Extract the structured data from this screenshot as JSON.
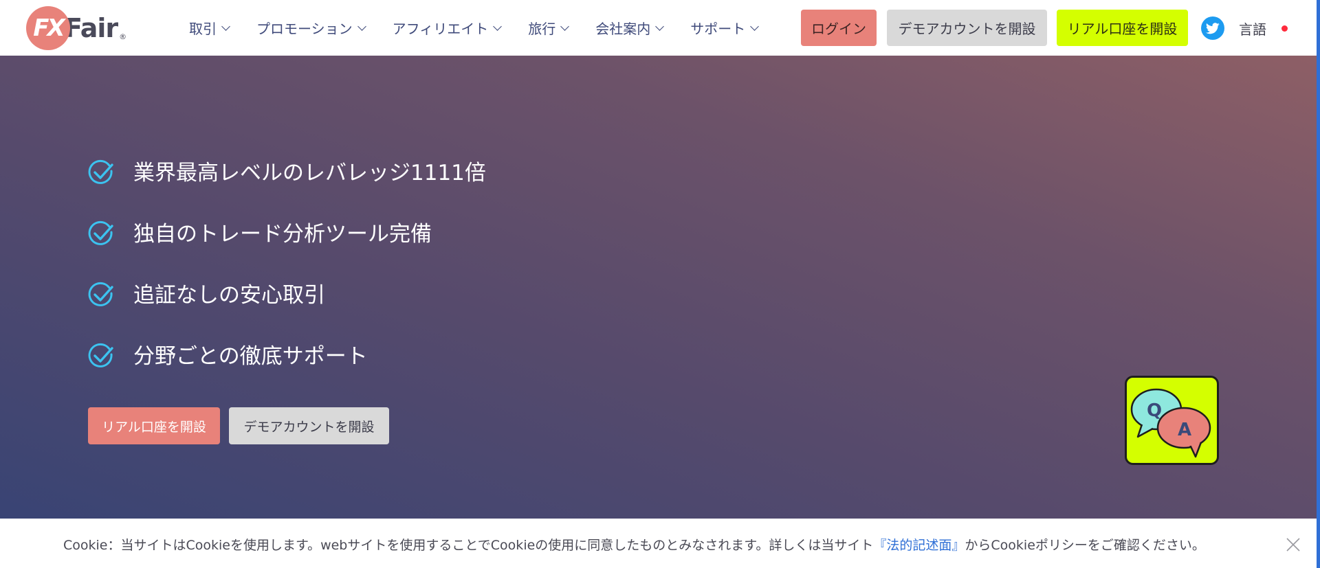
{
  "brand": {
    "mark": "FX",
    "word": "Fair",
    "reg": "®",
    "accent": "#e8827a",
    "lime": "#d4ff00"
  },
  "nav": {
    "items": [
      {
        "label": "取引"
      },
      {
        "label": "プロモーション"
      },
      {
        "label": "アフィリエイト"
      },
      {
        "label": "旅行"
      },
      {
        "label": "会社案内"
      },
      {
        "label": "サポート"
      }
    ],
    "login_label": "ログイン",
    "demo_label": "デモアカウントを開設",
    "real_label": "リアル口座を開設",
    "language_label": "言語",
    "twitter_icon": "twitter-icon"
  },
  "hero": {
    "features": [
      "業界最高レベルのレバレッジ1111倍",
      "独自のトレード分析ツール完備",
      "追証なしの安心取引",
      "分野ごとの徹底サポート"
    ],
    "real_button": "リアル口座を開設",
    "demo_button": "デモアカウントを開設",
    "qa": {
      "q": "Q",
      "a": "A"
    }
  },
  "cookie": {
    "before": "Cookie：当サイトはCookieを使用します。webサイトを使用することでCookieの使用に同意したものとみなされます。詳しくは当サイト",
    "link": "『法的記述面』",
    "after": "からCookieポリシーをご確認ください。"
  }
}
